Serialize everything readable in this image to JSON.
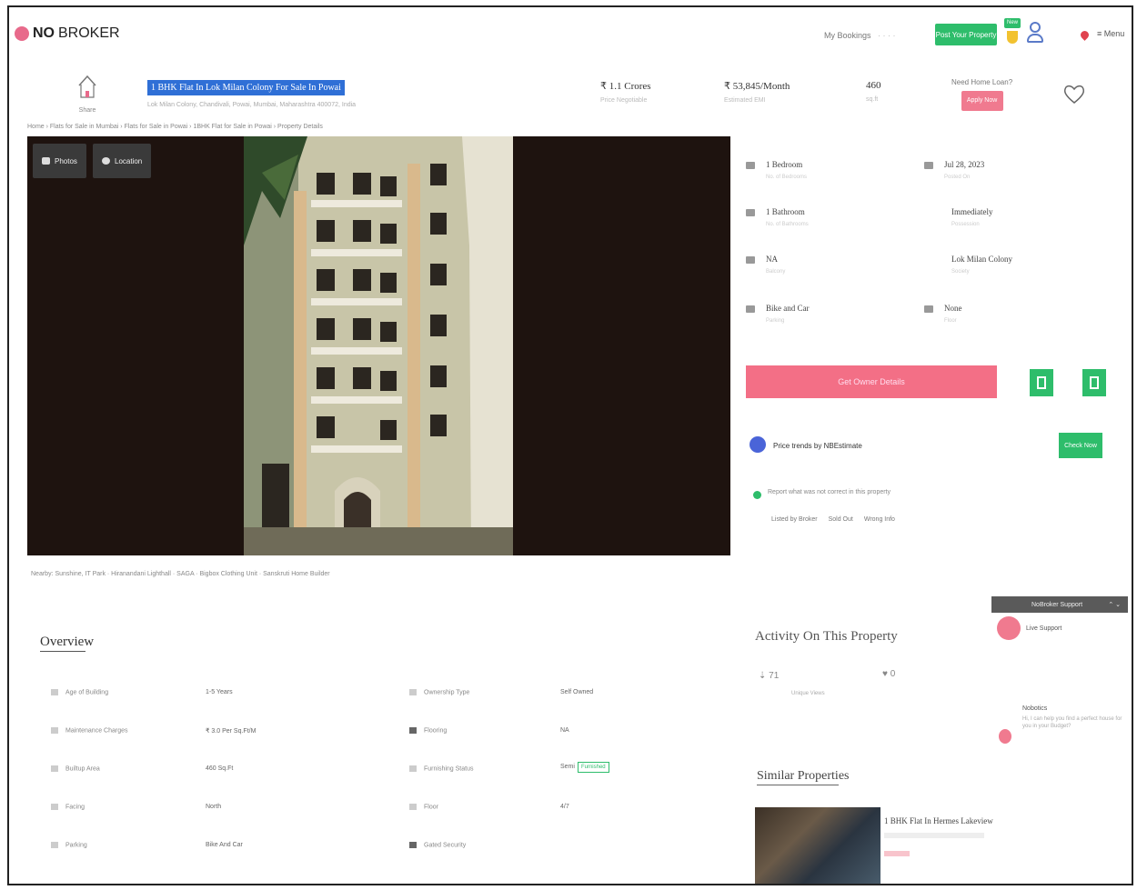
{
  "nav": {
    "logo_no": "NO",
    "logo_broker": "BROKER",
    "bookings": "My Bookings",
    "post_property": "Post Your Property",
    "trophy_badge": "New",
    "menu": "Menu"
  },
  "property": {
    "icon_label": "Share",
    "title": "1 BHK Flat In Lok Milan Colony For Sale In Powai",
    "address": "Lok Milan Colony, Chandivali, Powai, Mumbai, Maharashtra 400072, India",
    "price": "₹ 1.1 Crores",
    "price_label": "Price Negotiable",
    "emi": "₹ 53,845/Month",
    "emi_label": "Estimated EMI",
    "area": "460",
    "area_label": "sq.ft",
    "loan_question": "Need Home Loan?",
    "apply_label": "Apply Now"
  },
  "breadcrumb": "Home › Flats for Sale in Mumbai › Flats for Sale in Powai › 1BHK Flat for Sale in Powai › Property Details",
  "gallery": {
    "photos_label": "Photos",
    "location_label": "Location"
  },
  "nearby": "Nearby: Sunshine, IT Park · Hiranandani Lighthall · SAGA · Bigbox Clothing Unit · Sanskruti Home Builder",
  "details": [
    {
      "value": "1 Bedroom",
      "label": "No. of Bedrooms"
    },
    {
      "value": "Jul 28, 2023",
      "label": "Posted On"
    },
    {
      "value": "1 Bathroom",
      "label": "No. of Bathrooms"
    },
    {
      "value": "Immediately",
      "label": "Possession"
    },
    {
      "value": "NA",
      "label": "Balcony"
    },
    {
      "value": "Lok Milan Colony",
      "label": "Society"
    },
    {
      "value": "Bike and Car",
      "label": "Parking"
    },
    {
      "value": "None",
      "label": "Floor"
    }
  ],
  "actions": {
    "owner_details": "Get Owner Details",
    "estimate": "Price trends by NBEstimate",
    "check_now": "Check Now",
    "report": "Report what was not correct in this property",
    "report_tags": [
      "Listed by Broker",
      "Sold Out",
      "Wrong Info"
    ]
  },
  "overview": {
    "title": "Overview",
    "rows": [
      {
        "l1": "Age of Building",
        "v1": "1-5 Years",
        "l2": "Ownership Type",
        "v2": "Self Owned"
      },
      {
        "l1": "Maintenance Charges",
        "v1": "₹ 3.0 Per Sq.Ft/M",
        "l2": "Flooring",
        "v2": "NA"
      },
      {
        "l1": "Builtup Area",
        "v1": "460 Sq.Ft",
        "l2": "Furnishing Status",
        "v2": "Semi",
        "tag": "Furnished"
      },
      {
        "l1": "Facing",
        "v1": "North",
        "l2": "Floor",
        "v2": "4/7"
      },
      {
        "l1": "Parking",
        "v1": "Bike And Car",
        "l2": "Gated Security",
        "v2": ""
      }
    ]
  },
  "activity": {
    "title": "Activity On This Property",
    "views": "71",
    "views_label": "Unique Views",
    "shortlists": "0"
  },
  "support": {
    "header": "NoBroker Support",
    "live": "Live Support",
    "agent": "Nobotics",
    "message": "Hi, I can help you find a perfect house for you in your Budget?"
  },
  "similar": {
    "title": "Similar Properties",
    "name": "1 BHK Flat In Hermes Lakeview"
  },
  "colors": {
    "brand_pink": "#f36f86",
    "green": "#2ebd6b",
    "title_highlight": "#2f6fd6"
  }
}
